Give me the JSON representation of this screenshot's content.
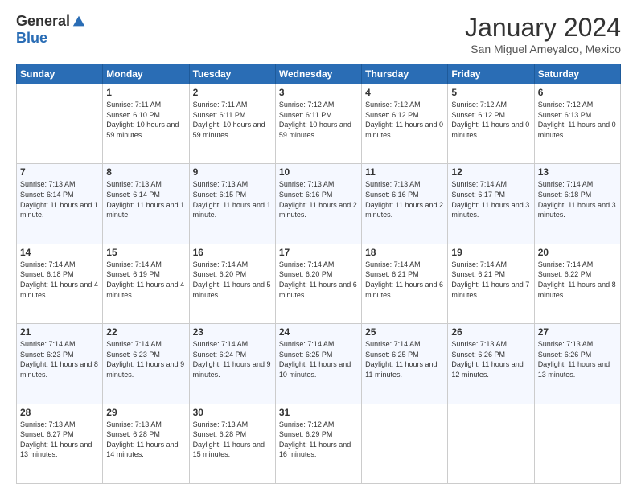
{
  "logo": {
    "general": "General",
    "blue": "Blue"
  },
  "header": {
    "month_year": "January 2024",
    "location": "San Miguel Ameyalco, Mexico"
  },
  "days_of_week": [
    "Sunday",
    "Monday",
    "Tuesday",
    "Wednesday",
    "Thursday",
    "Friday",
    "Saturday"
  ],
  "weeks": [
    [
      {
        "day": "",
        "info": ""
      },
      {
        "day": "1",
        "info": "Sunrise: 7:11 AM\nSunset: 6:10 PM\nDaylight: 10 hours and 59 minutes."
      },
      {
        "day": "2",
        "info": "Sunrise: 7:11 AM\nSunset: 6:11 PM\nDaylight: 10 hours and 59 minutes."
      },
      {
        "day": "3",
        "info": "Sunrise: 7:12 AM\nSunset: 6:11 PM\nDaylight: 10 hours and 59 minutes."
      },
      {
        "day": "4",
        "info": "Sunrise: 7:12 AM\nSunset: 6:12 PM\nDaylight: 11 hours and 0 minutes."
      },
      {
        "day": "5",
        "info": "Sunrise: 7:12 AM\nSunset: 6:12 PM\nDaylight: 11 hours and 0 minutes."
      },
      {
        "day": "6",
        "info": "Sunrise: 7:12 AM\nSunset: 6:13 PM\nDaylight: 11 hours and 0 minutes."
      }
    ],
    [
      {
        "day": "7",
        "info": "Sunrise: 7:13 AM\nSunset: 6:14 PM\nDaylight: 11 hours and 1 minute."
      },
      {
        "day": "8",
        "info": "Sunrise: 7:13 AM\nSunset: 6:14 PM\nDaylight: 11 hours and 1 minute."
      },
      {
        "day": "9",
        "info": "Sunrise: 7:13 AM\nSunset: 6:15 PM\nDaylight: 11 hours and 1 minute."
      },
      {
        "day": "10",
        "info": "Sunrise: 7:13 AM\nSunset: 6:16 PM\nDaylight: 11 hours and 2 minutes."
      },
      {
        "day": "11",
        "info": "Sunrise: 7:13 AM\nSunset: 6:16 PM\nDaylight: 11 hours and 2 minutes."
      },
      {
        "day": "12",
        "info": "Sunrise: 7:14 AM\nSunset: 6:17 PM\nDaylight: 11 hours and 3 minutes."
      },
      {
        "day": "13",
        "info": "Sunrise: 7:14 AM\nSunset: 6:18 PM\nDaylight: 11 hours and 3 minutes."
      }
    ],
    [
      {
        "day": "14",
        "info": "Sunrise: 7:14 AM\nSunset: 6:18 PM\nDaylight: 11 hours and 4 minutes."
      },
      {
        "day": "15",
        "info": "Sunrise: 7:14 AM\nSunset: 6:19 PM\nDaylight: 11 hours and 4 minutes."
      },
      {
        "day": "16",
        "info": "Sunrise: 7:14 AM\nSunset: 6:20 PM\nDaylight: 11 hours and 5 minutes."
      },
      {
        "day": "17",
        "info": "Sunrise: 7:14 AM\nSunset: 6:20 PM\nDaylight: 11 hours and 6 minutes."
      },
      {
        "day": "18",
        "info": "Sunrise: 7:14 AM\nSunset: 6:21 PM\nDaylight: 11 hours and 6 minutes."
      },
      {
        "day": "19",
        "info": "Sunrise: 7:14 AM\nSunset: 6:21 PM\nDaylight: 11 hours and 7 minutes."
      },
      {
        "day": "20",
        "info": "Sunrise: 7:14 AM\nSunset: 6:22 PM\nDaylight: 11 hours and 8 minutes."
      }
    ],
    [
      {
        "day": "21",
        "info": "Sunrise: 7:14 AM\nSunset: 6:23 PM\nDaylight: 11 hours and 8 minutes."
      },
      {
        "day": "22",
        "info": "Sunrise: 7:14 AM\nSunset: 6:23 PM\nDaylight: 11 hours and 9 minutes."
      },
      {
        "day": "23",
        "info": "Sunrise: 7:14 AM\nSunset: 6:24 PM\nDaylight: 11 hours and 9 minutes."
      },
      {
        "day": "24",
        "info": "Sunrise: 7:14 AM\nSunset: 6:25 PM\nDaylight: 11 hours and 10 minutes."
      },
      {
        "day": "25",
        "info": "Sunrise: 7:14 AM\nSunset: 6:25 PM\nDaylight: 11 hours and 11 minutes."
      },
      {
        "day": "26",
        "info": "Sunrise: 7:13 AM\nSunset: 6:26 PM\nDaylight: 11 hours and 12 minutes."
      },
      {
        "day": "27",
        "info": "Sunrise: 7:13 AM\nSunset: 6:26 PM\nDaylight: 11 hours and 13 minutes."
      }
    ],
    [
      {
        "day": "28",
        "info": "Sunrise: 7:13 AM\nSunset: 6:27 PM\nDaylight: 11 hours and 13 minutes."
      },
      {
        "day": "29",
        "info": "Sunrise: 7:13 AM\nSunset: 6:28 PM\nDaylight: 11 hours and 14 minutes."
      },
      {
        "day": "30",
        "info": "Sunrise: 7:13 AM\nSunset: 6:28 PM\nDaylight: 11 hours and 15 minutes."
      },
      {
        "day": "31",
        "info": "Sunrise: 7:12 AM\nSunset: 6:29 PM\nDaylight: 11 hours and 16 minutes."
      },
      {
        "day": "",
        "info": ""
      },
      {
        "day": "",
        "info": ""
      },
      {
        "day": "",
        "info": ""
      }
    ]
  ]
}
